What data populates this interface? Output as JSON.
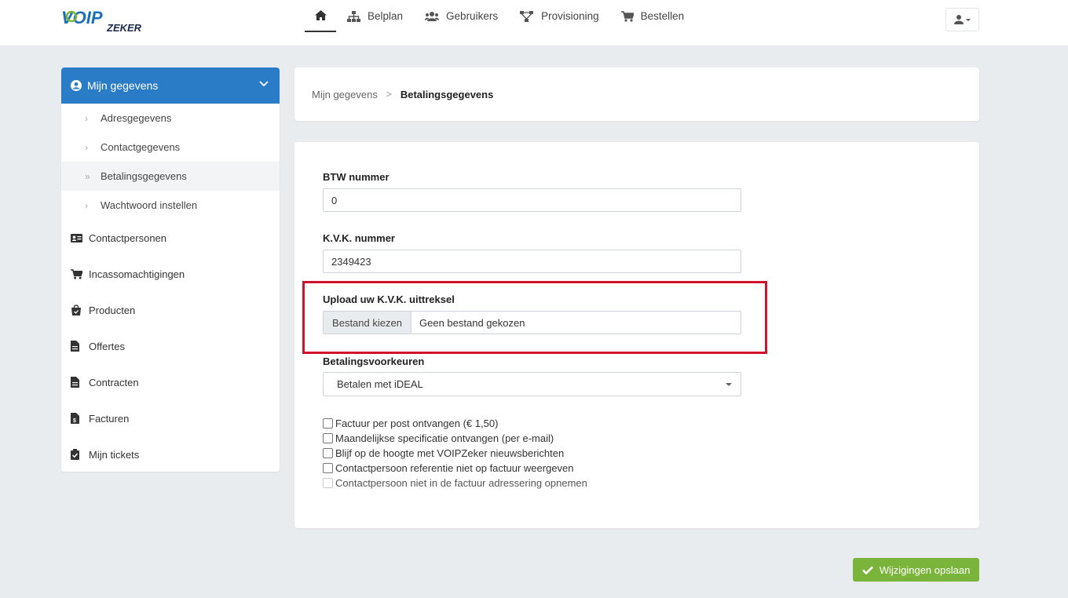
{
  "brand": {
    "logo_main": "VOIP",
    "logo_sub": "ZEKER",
    "color_primary": "#2b7cc6",
    "color_accent": "#7ab43a",
    "color_highlight": "#d0132b"
  },
  "nav": {
    "home_icon": "home-icon",
    "items": [
      {
        "label": "Belplan",
        "icon": "sitemap-icon"
      },
      {
        "label": "Gebruikers",
        "icon": "users-icon"
      },
      {
        "label": "Provisioning",
        "icon": "network-icon"
      },
      {
        "label": "Bestellen",
        "icon": "cart-icon"
      }
    ],
    "user_menu_icon": "user-icon"
  },
  "sidebar": {
    "header": "Mijn gegevens",
    "subitems": [
      "Adresgegevens",
      "Contactgegevens",
      "Betalingsgegevens",
      "Wachtwoord instellen"
    ],
    "active_subitem": "Betalingsgegevens",
    "items": [
      {
        "label": "Contactpersonen",
        "icon": "id-card-icon"
      },
      {
        "label": "Incassomachtigingen",
        "icon": "cart-icon"
      },
      {
        "label": "Producten",
        "icon": "shopping-bag-icon"
      },
      {
        "label": "Offertes",
        "icon": "file-icon"
      },
      {
        "label": "Contracten",
        "icon": "file-icon"
      },
      {
        "label": "Facturen",
        "icon": "invoice-icon"
      },
      {
        "label": "Mijn tickets",
        "icon": "clipboard-check-icon"
      }
    ]
  },
  "breadcrumb": {
    "parent": "Mijn gegevens",
    "current": "Betalingsgegevens"
  },
  "form": {
    "btw_label": "BTW nummer",
    "btw_value": "0",
    "kvk_label": "K.V.K. nummer",
    "kvk_value": "2349423",
    "upload_label": "Upload uw K.V.K. uittreksel",
    "upload_button": "Bestand kiezen",
    "upload_status": "Geen bestand gekozen",
    "payment_label": "Betalingsvoorkeuren",
    "payment_value": "Betalen met iDEAL",
    "checkboxes": [
      {
        "label": "Factuur per post ontvangen (€ 1,50)",
        "checked": false,
        "disabled": false
      },
      {
        "label": "Maandelijkse specificatie ontvangen (per e-mail)",
        "checked": false,
        "disabled": false
      },
      {
        "label": "Blijf op de hoogte met VOIPZeker nieuwsberichten",
        "checked": false,
        "disabled": false
      },
      {
        "label": "Contactpersoon referentie niet op factuur weergeven",
        "checked": false,
        "disabled": false
      },
      {
        "label": "Contactpersoon niet in de factuur adressering opnemen",
        "checked": false,
        "disabled": true
      }
    ]
  },
  "save_button": "Wijzigingen opslaan"
}
